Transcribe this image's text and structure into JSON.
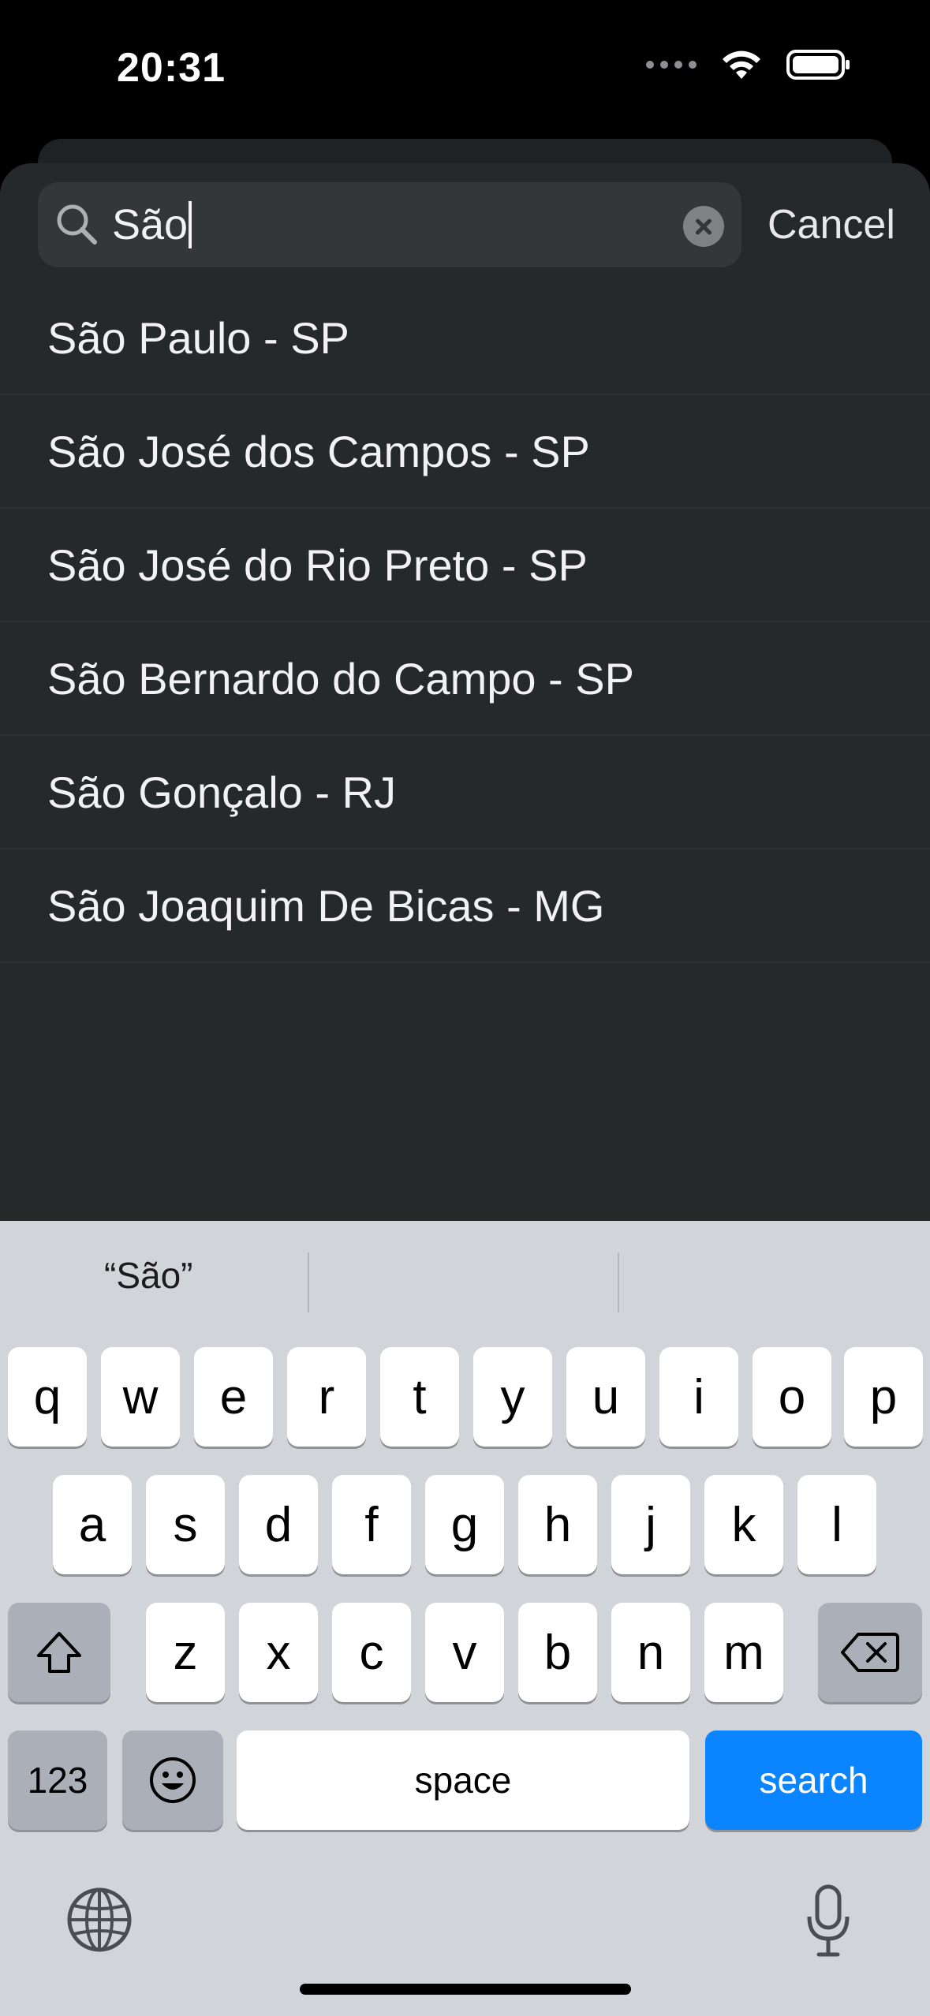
{
  "status": {
    "time": "20:31"
  },
  "search": {
    "value": "São",
    "cancel_label": "Cancel"
  },
  "results": [
    "São Paulo - SP",
    "São José dos Campos - SP",
    "São José do Rio Preto - SP",
    "São Bernardo do Campo - SP",
    "São Gonçalo - RJ",
    "São Joaquim De Bicas - MG"
  ],
  "keyboard": {
    "prediction": "“São”",
    "row1": [
      "q",
      "w",
      "e",
      "r",
      "t",
      "y",
      "u",
      "i",
      "o",
      "p"
    ],
    "row2": [
      "a",
      "s",
      "d",
      "f",
      "g",
      "h",
      "j",
      "k",
      "l"
    ],
    "row3": [
      "z",
      "x",
      "c",
      "v",
      "b",
      "n",
      "m"
    ],
    "numbers_label": "123",
    "space_label": "space",
    "search_label": "search"
  },
  "colors": {
    "accent": "#0a84ff",
    "sheet_bg": "#25292a",
    "keyboard_bg": "#d1d4d9"
  }
}
